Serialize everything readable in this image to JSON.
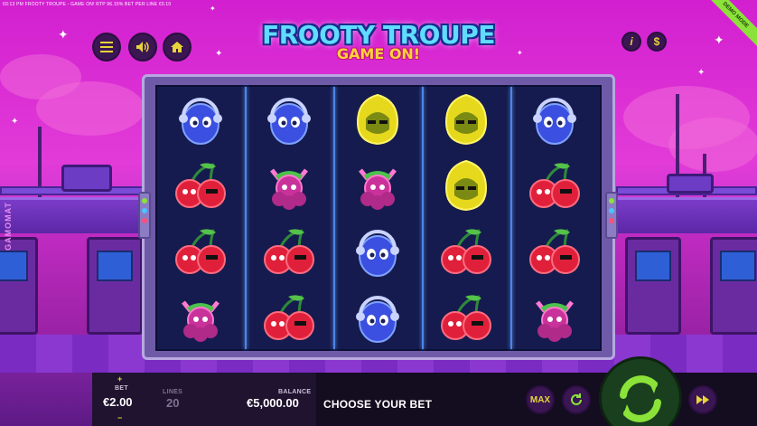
{
  "header": {
    "info_text": "03:13 PM  FROOTY TROUPE - GAME ON!  RTP 96.15%  BET PER LINE €0.10",
    "demo_label": "DEMO MODE"
  },
  "title": {
    "line1": "FROOTY TROUPE",
    "line2": "GAME ON!"
  },
  "side_brand": "GAMOMAT",
  "controls": {
    "menu_icon": "hamburger-menu-icon",
    "sound_icon": "speaker-icon",
    "home_icon": "home-icon",
    "info_label": "i",
    "paytable_label": "$"
  },
  "reels": [
    [
      "plum",
      "cherry",
      "cherry",
      "grape"
    ],
    [
      "plum",
      "grape",
      "cherry",
      "cherry"
    ],
    [
      "lemon",
      "grape",
      "plum",
      "plum"
    ],
    [
      "lemon",
      "lemon",
      "cherry",
      "cherry"
    ],
    [
      "plum",
      "cherry",
      "cherry",
      "grape"
    ]
  ],
  "bottom": {
    "bet_label": "BET",
    "bet_value": "€2.00",
    "bet_plus": "+",
    "bet_minus": "−",
    "lines_label": "LINES",
    "lines_value": "20",
    "balance_label": "BALANCE",
    "balance_value": "€5,000.00",
    "message": "CHOOSE YOUR BET",
    "max_label": "MAX"
  },
  "colors": {
    "accent_yellow": "#e6d43a",
    "spin_green": "#8be33a",
    "reel_bg": "#151b4e"
  }
}
